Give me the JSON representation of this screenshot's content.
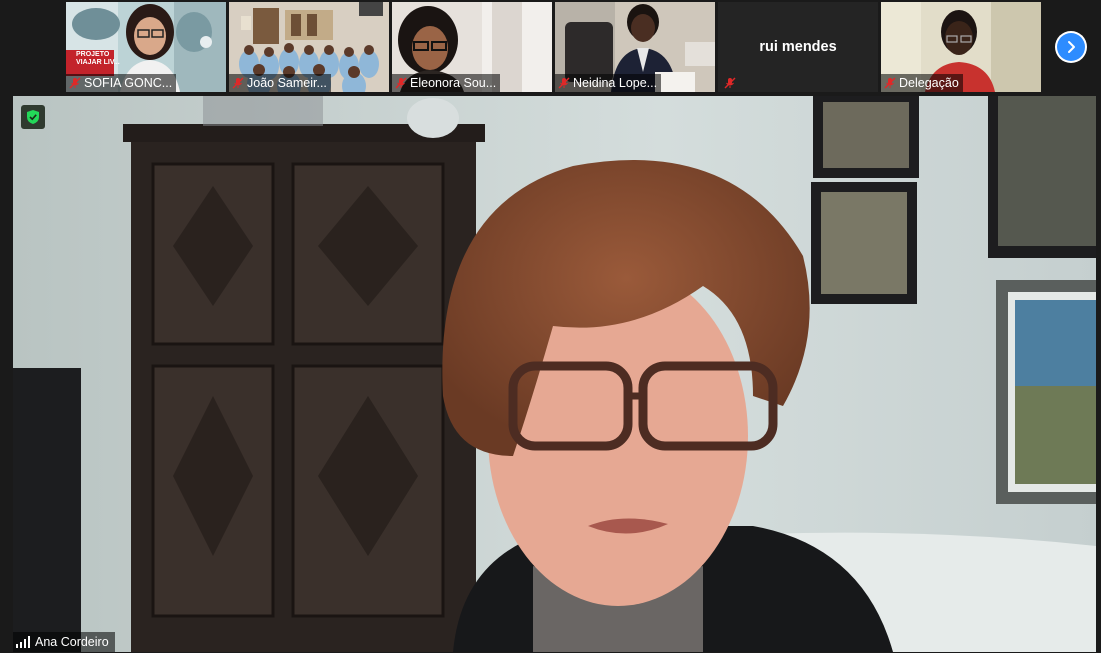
{
  "participants": [
    {
      "name": "SOFIA GONC...",
      "muted": true,
      "video_text": "PROJETO VIAJAR LIV..."
    },
    {
      "name": "João Sameir...",
      "muted": true
    },
    {
      "name": "Eleonora Sou...",
      "muted": true
    },
    {
      "name": "Neidina Lope...",
      "muted": true
    },
    {
      "name": "rui mendes",
      "muted": true,
      "video_off": true
    },
    {
      "name": "Delegação",
      "muted": true
    }
  ],
  "gallery_next": {
    "icon": "chevron-right-icon"
  },
  "active_speaker": {
    "name": "Ana Cordeiro",
    "signal_icon": "signal-bars-icon",
    "badge_icon": "shield-check-icon"
  },
  "colors": {
    "accent": "#2d8cff",
    "muted_mic": "#e02828",
    "verified": "#23d959"
  }
}
